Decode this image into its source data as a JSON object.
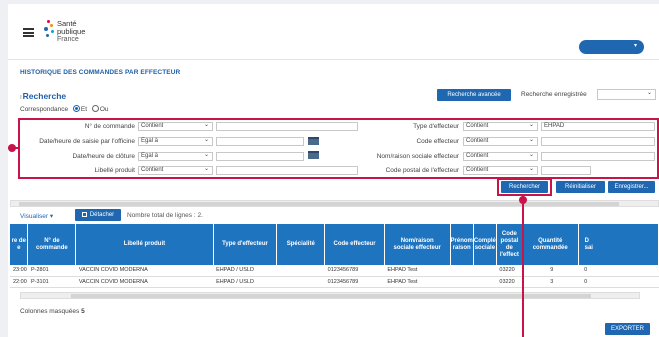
{
  "header": {
    "logo_line1": "Santé",
    "logo_line2": "publique",
    "logo_line3": "France",
    "user_chevron": "▾"
  },
  "page_title": "HISTORIQUE DES COMMANDES PAR EFFECTEUR",
  "section_title": "Recherche",
  "correspondance": {
    "label": "Correspondance",
    "opt_et": "Et",
    "opt_ou": "Ou"
  },
  "advanced_button": "Recherche avancée",
  "saved_search_label": "Recherche enregistrée",
  "filters": {
    "num_commande": {
      "label": "N° de commande",
      "op": "Contient"
    },
    "date_saisie": {
      "label": "Date/heure de saisie par l'officine",
      "op": "Egal à"
    },
    "date_cloture": {
      "label": "Date/heure de clôture",
      "op": "Egal à"
    },
    "libelle": {
      "label": "Libellé produit",
      "op": "Contient"
    },
    "type_effecteur": {
      "label": "Type d'effecteur",
      "op": "Contient",
      "value": "EHPAD"
    },
    "code_effecteur": {
      "label": "Code effecteur",
      "op": "Contient"
    },
    "nom_raison": {
      "label": "Nom/raison sociale effecteur",
      "op": "Contient"
    },
    "code_postal": {
      "label": "Code postal de l'effecteur",
      "op": "Contient"
    }
  },
  "actions": {
    "search": "Rechercher",
    "reset": "Réinitialiser",
    "save": "Enregistrer..."
  },
  "toolbar": {
    "view": "Visualiser",
    "detach": "Détacher",
    "row_count": "Nombre total de lignes : 2."
  },
  "table": {
    "headers": [
      "re de\ne",
      "N° de\ncommande",
      "Libellé produit",
      "Type d'effecteur",
      "Spécialité",
      "Code effecteur",
      "Nom/raison\nsociale effecteur",
      "Prénom\nraison",
      "Complé\nsociale",
      "Code\npostal\nde\nl'effect",
      "Quantité\ncommandée",
      "D\nsai"
    ],
    "rows": [
      [
        "23:00",
        "P-2801",
        "VACCIN COVID MODERNA",
        "EHPAD / USLD",
        "",
        "0123456789",
        "EHPAD Test",
        "",
        "",
        "03220",
        "9",
        "0"
      ],
      [
        "22:00",
        "P-3101",
        "VACCIN COVID MODERNA",
        "EHPAD / USLD",
        "",
        "0123456789",
        "EHPAD Test",
        "",
        "",
        "03220",
        "3",
        "0"
      ]
    ]
  },
  "hidden_columns": {
    "label": "Colonnes masquées",
    "count": "5"
  },
  "export_button": "EXPORTER",
  "colors": {
    "accent": "#1f67b0",
    "highlight": "#c8144a",
    "table_header": "#1f74c0"
  }
}
